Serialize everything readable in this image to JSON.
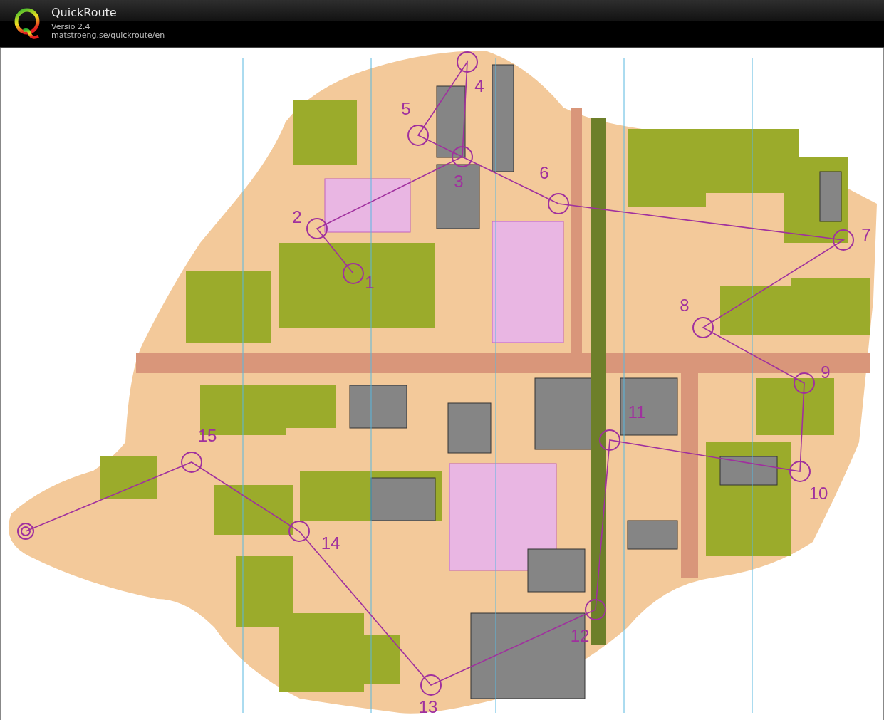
{
  "app": {
    "title": "QuickRoute",
    "version": "Versio 2.4",
    "url": "matstroeng.se/quickroute/en"
  },
  "map": {
    "controls": [
      {
        "label": "1"
      },
      {
        "label": "2"
      },
      {
        "label": "3"
      },
      {
        "label": "4"
      },
      {
        "label": "5"
      },
      {
        "label": "6"
      },
      {
        "label": "7"
      },
      {
        "label": "8"
      },
      {
        "label": "9"
      },
      {
        "label": "10"
      },
      {
        "label": "11"
      },
      {
        "label": "12"
      },
      {
        "label": "13"
      },
      {
        "label": "14"
      },
      {
        "label": "15"
      }
    ]
  }
}
